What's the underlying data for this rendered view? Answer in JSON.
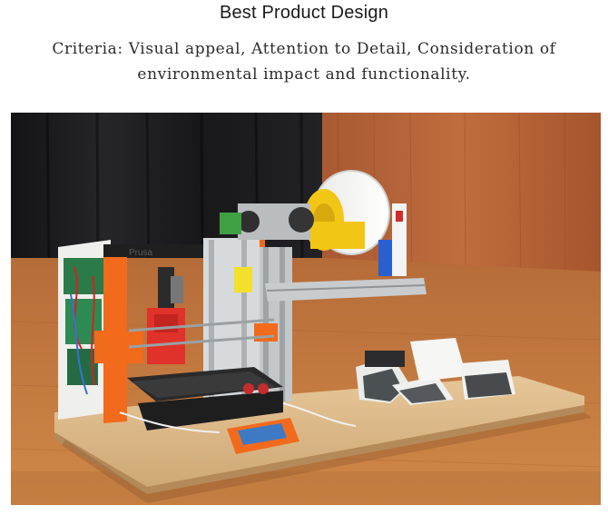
{
  "header": {
    "title": "Best Product Design",
    "criteria": "Criteria: Visual appeal, Attention to Detail, Consideration of environmental impact and functionality."
  },
  "photo": {
    "subject": "product-photo",
    "frame_label": "Prusa",
    "colors": {
      "curtain": "#1c1c1f",
      "wood_wall": "#b5643a",
      "floor": "#c57a42",
      "board": "#dcb98a",
      "frame_orange": "#f26a1b",
      "printhead_red": "#e0322a",
      "spool_yellow": "#f2c614",
      "aluminum": "#bfc3c6"
    }
  }
}
